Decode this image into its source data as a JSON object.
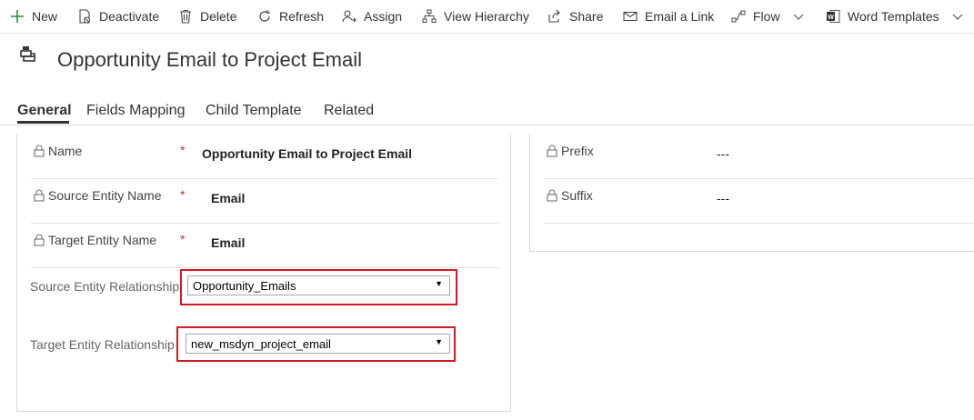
{
  "toolbar": {
    "new": "New",
    "deactivate": "Deactivate",
    "delete": "Delete",
    "refresh": "Refresh",
    "assign": "Assign",
    "view_hierarchy": "View Hierarchy",
    "share": "Share",
    "email_link": "Email a Link",
    "flow": "Flow",
    "word_templates": "Word Templates"
  },
  "header": {
    "title": "Opportunity Email to Project Email"
  },
  "tabs": [
    {
      "label": "General"
    },
    {
      "label": "Fields Mapping"
    },
    {
      "label": "Child Template"
    },
    {
      "label": "Related"
    }
  ],
  "left_section": {
    "name": {
      "label": "Name",
      "value": "Opportunity Email to Project Email"
    },
    "source_entity_name": {
      "label": "Source Entity Name",
      "value": "Email"
    },
    "target_entity_name": {
      "label": "Target Entity Name",
      "value": "Email"
    },
    "source_relationship": {
      "label": "Source Entity Relationship",
      "value": "Opportunity_Emails"
    },
    "target_relationship": {
      "label": "Target Entity Relationship",
      "value": "new_msdyn_project_email"
    },
    "required_marker": "*"
  },
  "right_section": {
    "prefix": {
      "label": "Prefix",
      "value": "---"
    },
    "suffix": {
      "label": "Suffix",
      "value": "---"
    }
  },
  "colors": {
    "highlight_border": "#d11a24",
    "required": "#c0302b",
    "new_icon": "#2e8b3e",
    "word_icon": "#2b579a"
  },
  "icons": {
    "new": "plus-icon",
    "deactivate": "document-deactivate-icon",
    "delete": "trash-icon",
    "refresh": "refresh-icon",
    "assign": "person-assign-icon",
    "view_hierarchy": "hierarchy-icon",
    "share": "share-icon",
    "email_link": "email-icon",
    "flow": "flow-icon",
    "word_templates": "word-icon",
    "lock": "lock-icon",
    "dropdown": "chevron-down-icon"
  }
}
